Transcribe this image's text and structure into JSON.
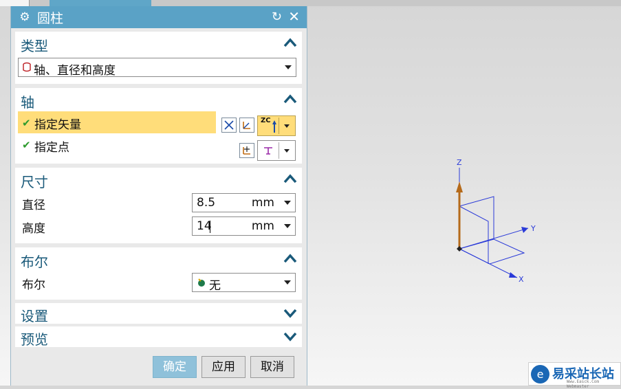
{
  "dialog": {
    "title": "圆柱",
    "sections": {
      "type": {
        "title": "类型",
        "selected": "轴、直径和高度"
      },
      "axis": {
        "title": "轴",
        "specify_vector": "指定矢量",
        "specify_point": "指定点",
        "vector_dropdown_label": "ZC"
      },
      "dimensions": {
        "title": "尺寸",
        "diameter_label": "直径",
        "diameter_value": "8.5",
        "diameter_unit": "mm",
        "height_label": "高度",
        "height_value": "14",
        "height_unit": "mm"
      },
      "boolean": {
        "title": "布尔",
        "label": "布尔",
        "value": "无"
      },
      "settings": {
        "title": "设置"
      },
      "preview": {
        "title": "预览"
      }
    },
    "buttons": {
      "ok": "确定",
      "apply": "应用",
      "cancel": "取消"
    }
  },
  "viewport": {
    "axis_labels": {
      "z": "Z",
      "y": "Y",
      "x": "X"
    },
    "colors": {
      "axis": "#1a1aff",
      "vector": "#b56a1a"
    }
  },
  "watermark": {
    "name": "易采站长站",
    "sub": "Www.Easck.Com Webmaster"
  }
}
